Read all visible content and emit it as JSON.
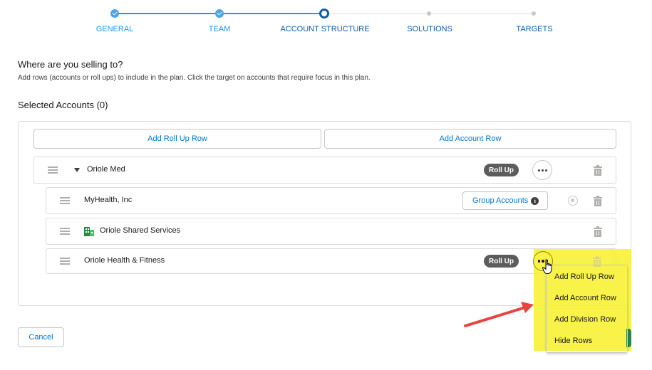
{
  "stepper": {
    "steps": [
      {
        "label": "GENERAL",
        "state": "done"
      },
      {
        "label": "TEAM",
        "state": "done"
      },
      {
        "label": "ACCOUNT STRUCTURE",
        "state": "active"
      },
      {
        "label": "SOLUTIONS",
        "state": "todo"
      },
      {
        "label": "TARGETS",
        "state": "todo"
      }
    ]
  },
  "heading": {
    "question": "Where are you selling to?",
    "description": "Add rows (accounts or roll ups) to include in the plan. Click the target on accounts that require focus in this plan.",
    "selected_accounts": "Selected Accounts (0)"
  },
  "toolbar": {
    "add_roll_up_row": "Add Roll Up Row",
    "add_account_row": "Add Account Row"
  },
  "rows": [
    {
      "label": "Oriole Med",
      "badge": "Roll Up"
    },
    {
      "label": "MyHealth, Inc",
      "group_button": "Group Accounts"
    },
    {
      "label": "Oriole Shared Services"
    },
    {
      "label": "Oriole Health & Fitness",
      "badge": "Roll Up"
    }
  ],
  "menu": {
    "items": [
      "Add Roll Up Row",
      "Add Account Row",
      "Add Division Row",
      "Hide Rows"
    ]
  },
  "footer": {
    "cancel": "Cancel"
  },
  "colors": {
    "accent": "#0176d3",
    "progress_done": "#1b96ff",
    "badge": "#5c5c5c",
    "highlight": "#f7f13a",
    "arrow": "#e8433f"
  }
}
